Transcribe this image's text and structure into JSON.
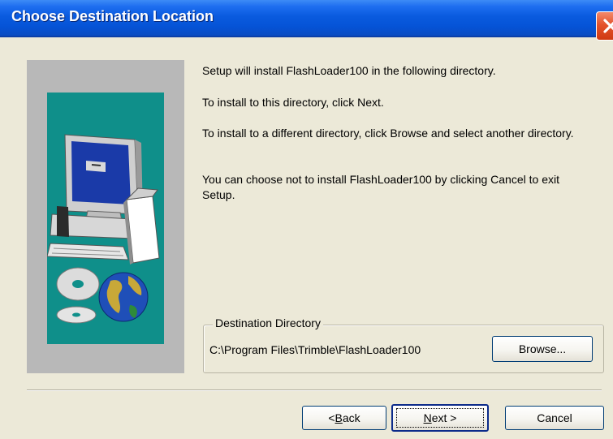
{
  "window": {
    "title": "Choose Destination Location",
    "close_icon": "close-x-icon"
  },
  "messages": [
    "Setup will install FlashLoader100 in the following directory.",
    "To install to this directory, click Next.",
    "To install to a different directory, click Browse and select another directory.",
    "You can choose not to install FlashLoader100 by clicking Cancel to exit Setup."
  ],
  "destination": {
    "label": "Destination Directory",
    "path": "C:\\Program Files\\Trimble\\FlashLoader100",
    "browse_label": "Browse..."
  },
  "buttons": {
    "back": {
      "prefix": "< ",
      "mnemonic": "B",
      "rest": "ack"
    },
    "next": {
      "mnemonic": "N",
      "rest": "ext >"
    },
    "cancel": "Cancel"
  },
  "colors": {
    "titlebar": "#0553d6",
    "dialog_bg": "#ece9d8",
    "art_teal": "#0f8f8a",
    "art_gray": "#b8b8b8",
    "close_button": "#e4532c"
  },
  "illustration": {
    "icons": [
      "computer-icon",
      "cd-disc-icon",
      "globe-icon"
    ]
  }
}
